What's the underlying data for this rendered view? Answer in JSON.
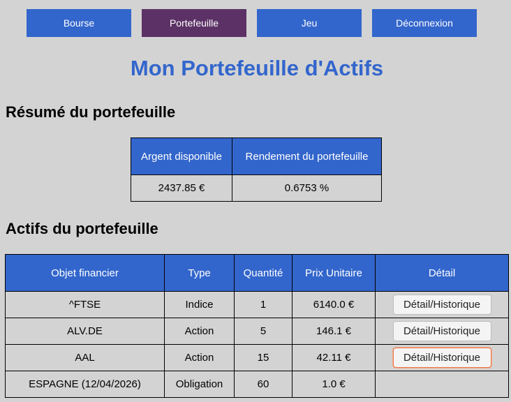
{
  "nav": {
    "items": [
      {
        "label": "Bourse",
        "active": false
      },
      {
        "label": "Portefeuille",
        "active": true
      },
      {
        "label": "Jeu",
        "active": false
      },
      {
        "label": "Déconnexion",
        "active": false
      }
    ]
  },
  "page_title": "Mon Portefeuille d'Actifs",
  "summary": {
    "title": "Résumé du portefeuille",
    "headers": [
      "Argent disponible",
      "Rendement du portefeuille"
    ],
    "values": [
      "2437.85 €",
      "0.6753 %"
    ]
  },
  "assets": {
    "title": "Actifs du portefeuille",
    "headers": [
      "Objet financier",
      "Type",
      "Quantité",
      "Prix Unitaire",
      "Détail"
    ],
    "rows": [
      {
        "name": "^FTSE",
        "type": "Indice",
        "quantity": "1",
        "price": "6140.0 €",
        "detail": "Détail/Historique"
      },
      {
        "name": "ALV.DE",
        "type": "Action",
        "quantity": "5",
        "price": "146.1 €",
        "detail": "Détail/Historique"
      },
      {
        "name": "AAL",
        "type": "Action",
        "quantity": "15",
        "price": "42.11 €",
        "detail": "Détail/Historique"
      },
      {
        "name": "ESPAGNE (12/04/2026)",
        "type": "Obligation",
        "quantity": "60",
        "price": "1.0 €",
        "detail": ""
      }
    ]
  },
  "colors": {
    "nav_bg": "#3366cc",
    "nav_active_bg": "#5c3266",
    "title": "#3366cc",
    "table_header_bg": "#3366cc",
    "page_bg": "#d3d3d3"
  }
}
